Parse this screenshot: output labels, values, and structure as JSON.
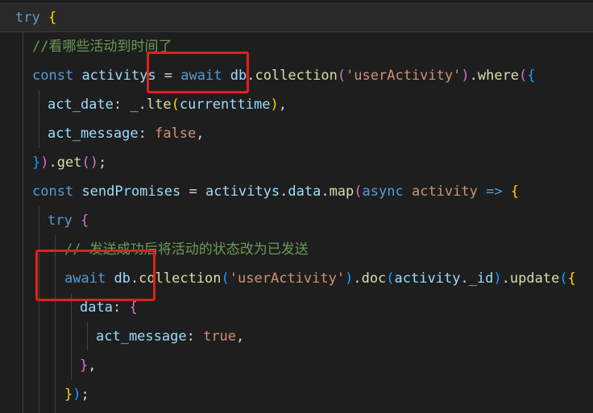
{
  "editor": {
    "lines": [
      {
        "tokens": [
          {
            "t": "try",
            "c": "storage"
          },
          {
            "t": " ",
            "c": "plain"
          },
          {
            "t": "{",
            "c": "brace1"
          }
        ]
      },
      {
        "tokens": [
          {
            "t": "//看哪些活动到时间了",
            "c": "comment"
          }
        ]
      },
      {
        "tokens": [
          {
            "t": "const",
            "c": "storage"
          },
          {
            "t": " ",
            "c": "plain"
          },
          {
            "t": "activitys",
            "c": "var"
          },
          {
            "t": " = ",
            "c": "plain"
          },
          {
            "t": "await",
            "c": "storage"
          },
          {
            "t": " ",
            "c": "plain"
          },
          {
            "t": "db",
            "c": "var"
          },
          {
            "t": ".",
            "c": "plain"
          },
          {
            "t": "collection",
            "c": "fn"
          },
          {
            "t": "(",
            "c": "brace2"
          },
          {
            "t": "'userActivity'",
            "c": "str"
          },
          {
            "t": ")",
            "c": "brace2"
          },
          {
            "t": ".",
            "c": "plain"
          },
          {
            "t": "where",
            "c": "fn"
          },
          {
            "t": "(",
            "c": "brace2"
          },
          {
            "t": "{",
            "c": "brace3"
          }
        ]
      },
      {
        "tokens": [
          {
            "t": "act_date",
            "c": "prop"
          },
          {
            "t": ": ",
            "c": "plain"
          },
          {
            "t": "_",
            "c": "var"
          },
          {
            "t": ".",
            "c": "plain"
          },
          {
            "t": "lte",
            "c": "fn"
          },
          {
            "t": "(",
            "c": "brace1"
          },
          {
            "t": "currenttime",
            "c": "var"
          },
          {
            "t": ")",
            "c": "brace1"
          },
          {
            "t": ",",
            "c": "plain"
          }
        ]
      },
      {
        "tokens": [
          {
            "t": "act_message",
            "c": "prop"
          },
          {
            "t": ": ",
            "c": "plain"
          },
          {
            "t": "false",
            "c": "str"
          },
          {
            "t": ",",
            "c": "plain"
          }
        ]
      },
      {
        "tokens": [
          {
            "t": "}",
            "c": "brace3"
          },
          {
            "t": ")",
            "c": "brace2"
          },
          {
            "t": ".",
            "c": "plain"
          },
          {
            "t": "get",
            "c": "fn"
          },
          {
            "t": "()",
            "c": "brace2"
          },
          {
            "t": ";",
            "c": "plain"
          }
        ]
      },
      {
        "tokens": [
          {
            "t": "const",
            "c": "storage"
          },
          {
            "t": " ",
            "c": "plain"
          },
          {
            "t": "sendPromises",
            "c": "var"
          },
          {
            "t": " = ",
            "c": "plain"
          },
          {
            "t": "activitys",
            "c": "var"
          },
          {
            "t": ".",
            "c": "plain"
          },
          {
            "t": "data",
            "c": "var"
          },
          {
            "t": ".",
            "c": "plain"
          },
          {
            "t": "map",
            "c": "fn"
          },
          {
            "t": "(",
            "c": "brace2"
          },
          {
            "t": "async",
            "c": "storage"
          },
          {
            "t": " ",
            "c": "plain"
          },
          {
            "t": "activity",
            "c": "str"
          },
          {
            "t": " ",
            "c": "plain"
          },
          {
            "t": "=>",
            "c": "storage"
          },
          {
            "t": " ",
            "c": "plain"
          },
          {
            "t": "{",
            "c": "brace1"
          }
        ]
      },
      {
        "tokens": [
          {
            "t": "try",
            "c": "storage"
          },
          {
            "t": " ",
            "c": "plain"
          },
          {
            "t": "{",
            "c": "brace2"
          }
        ]
      },
      {
        "tokens": [
          {
            "t": "// 发送成功后将活动的状态改为已发送",
            "c": "comment"
          }
        ]
      },
      {
        "tokens": [
          {
            "t": "await",
            "c": "storage"
          },
          {
            "t": " ",
            "c": "plain"
          },
          {
            "t": "db",
            "c": "var"
          },
          {
            "t": ".",
            "c": "plain"
          },
          {
            "t": "collection",
            "c": "fn"
          },
          {
            "t": "(",
            "c": "brace3"
          },
          {
            "t": "'userActivity'",
            "c": "str"
          },
          {
            "t": ")",
            "c": "brace3"
          },
          {
            "t": ".",
            "c": "plain"
          },
          {
            "t": "doc",
            "c": "fn"
          },
          {
            "t": "(",
            "c": "brace3"
          },
          {
            "t": "activity",
            "c": "var"
          },
          {
            "t": ".",
            "c": "plain"
          },
          {
            "t": "_id",
            "c": "var"
          },
          {
            "t": ")",
            "c": "brace3"
          },
          {
            "t": ".",
            "c": "plain"
          },
          {
            "t": "update",
            "c": "fn"
          },
          {
            "t": "(",
            "c": "brace3"
          },
          {
            "t": "{",
            "c": "brace1"
          }
        ]
      },
      {
        "tokens": [
          {
            "t": "data",
            "c": "prop"
          },
          {
            "t": ": ",
            "c": "plain"
          },
          {
            "t": "{",
            "c": "brace2"
          }
        ]
      },
      {
        "tokens": [
          {
            "t": "act_message",
            "c": "prop"
          },
          {
            "t": ": ",
            "c": "plain"
          },
          {
            "t": "true",
            "c": "str"
          },
          {
            "t": ",",
            "c": "plain"
          }
        ]
      },
      {
        "tokens": [
          {
            "t": "}",
            "c": "brace2"
          },
          {
            "t": ",",
            "c": "plain"
          }
        ]
      },
      {
        "tokens": [
          {
            "t": "}",
            "c": "brace1"
          },
          {
            "t": ")",
            "c": "brace3"
          },
          {
            "t": ";",
            "c": "plain"
          }
        ]
      }
    ]
  },
  "colors": {
    "background": "#1e1e1e",
    "annotation": "#e02020"
  }
}
